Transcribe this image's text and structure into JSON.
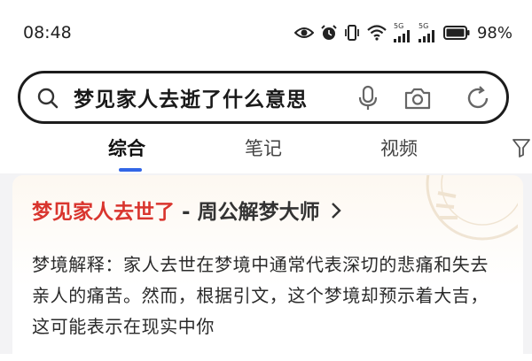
{
  "status_bar": {
    "time": "08:48",
    "net_tag_1": "5G",
    "net_tag_2": "5G",
    "battery": "98%",
    "icons": [
      "eye-icon",
      "alarm-icon",
      "vibrate-icon",
      "wifi-icon",
      "signal-icon",
      "signal-icon",
      "battery-icon"
    ]
  },
  "search": {
    "query": "梦见家人去逝了什么意思",
    "icons": [
      "search-icon",
      "mic-icon",
      "camera-icon",
      "refresh-icon"
    ]
  },
  "tabs": [
    {
      "label": "综合",
      "active": true
    },
    {
      "label": "笔记",
      "active": false
    },
    {
      "label": "视频",
      "active": false
    }
  ],
  "result": {
    "title_main": "梦见家人去世了",
    "title_sep": " - ",
    "title_source": "周公解梦大师",
    "snippet": "梦境解释：家人去世在梦境中通常代表深切的悲痛和失去亲人的痛苦。然而，根据引文，这个梦境却预示着大吉，这可能表示在现实中你"
  },
  "colors": {
    "accent": "#3266e6",
    "title_red": "#d9352e",
    "card_bg": "#fdf8f1"
  }
}
